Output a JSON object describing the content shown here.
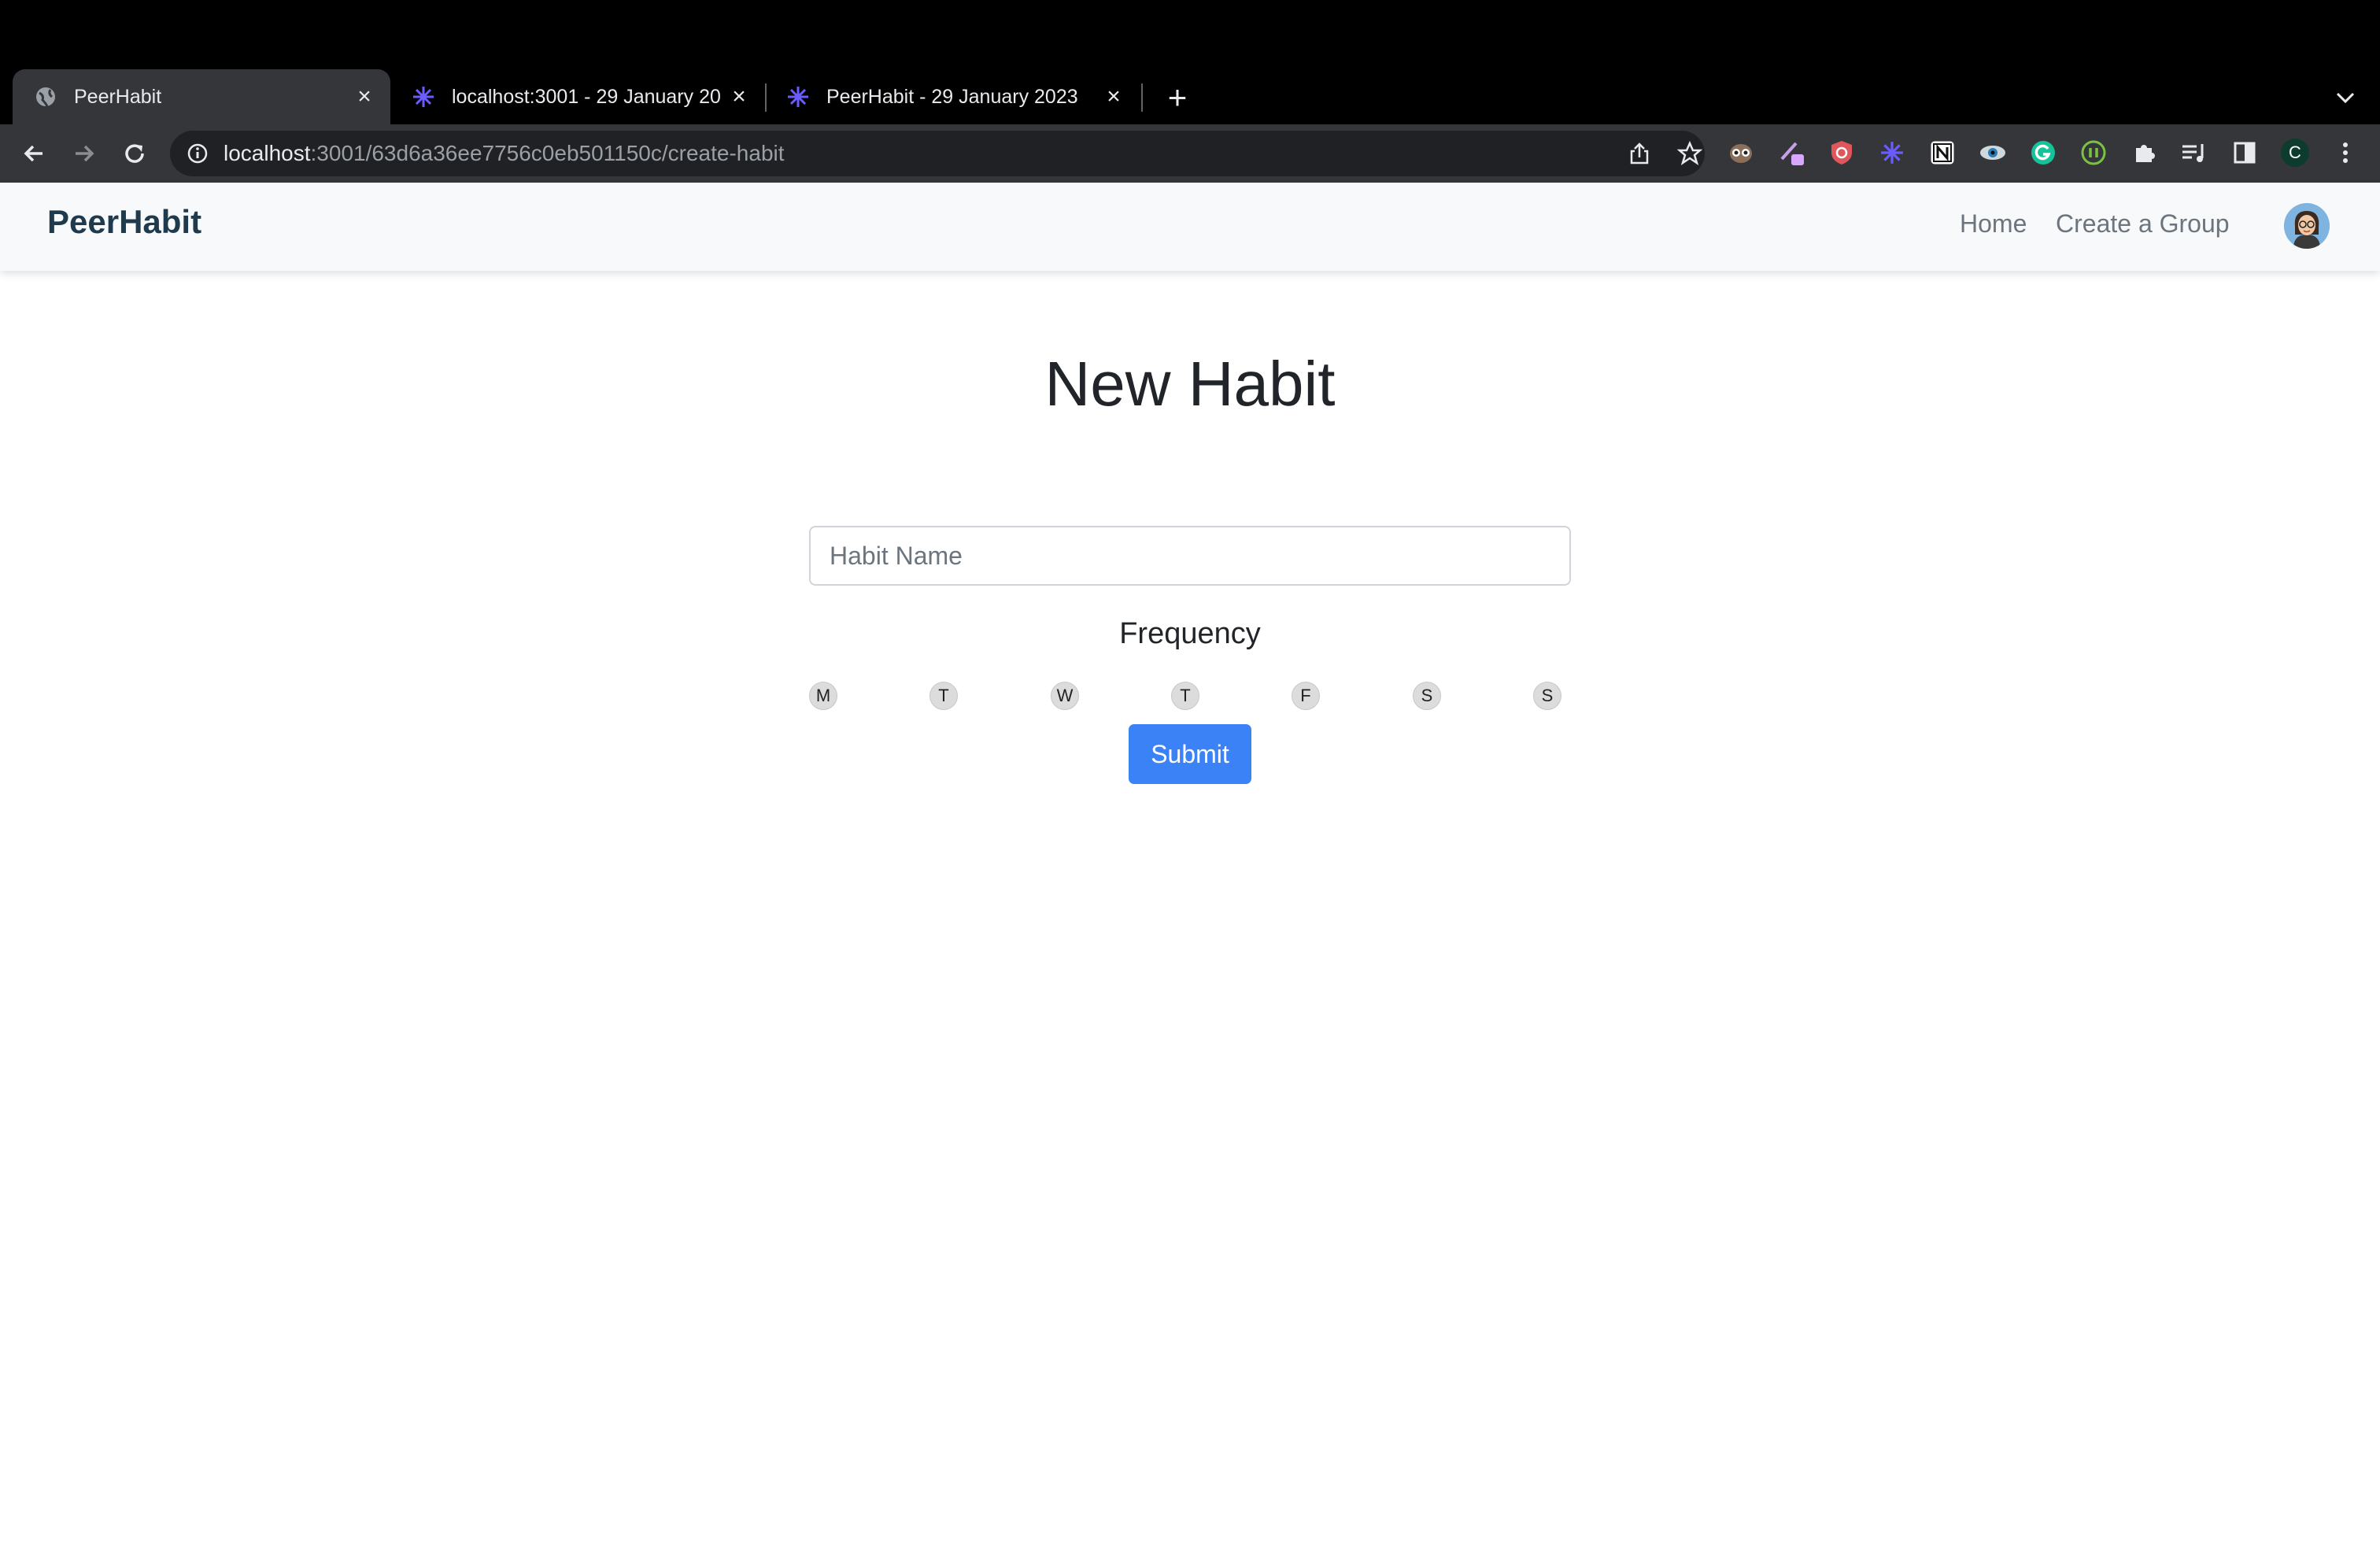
{
  "browser": {
    "tabs": [
      {
        "title": "PeerHabit",
        "active": true
      },
      {
        "title": "localhost:3001 - 29 January 20",
        "active": false
      },
      {
        "title": "PeerHabit - 29 January 2023",
        "active": false
      }
    ],
    "url_host": "localhost",
    "url_path": ":3001/63d6a36ee7756c0eb501150c/create-habit",
    "profile_initial": "C",
    "colors": {
      "chrome_bg": "#000000",
      "toolbar_bg": "#35363a",
      "omnibox_bg": "#202124"
    }
  },
  "app": {
    "brand": "PeerHabit",
    "nav": {
      "home": "Home",
      "create_group": "Create a Group"
    }
  },
  "form": {
    "title": "New Habit",
    "habit_name_placeholder": "Habit Name",
    "habit_name_value": "",
    "frequency_label": "Frequency",
    "days": [
      "M",
      "T",
      "W",
      "T",
      "F",
      "S",
      "S"
    ],
    "submit_label": "Submit"
  },
  "colors": {
    "primary": "#3b82f6",
    "brand": "#1e3a4c",
    "navbar_bg": "#f8f9fa"
  }
}
